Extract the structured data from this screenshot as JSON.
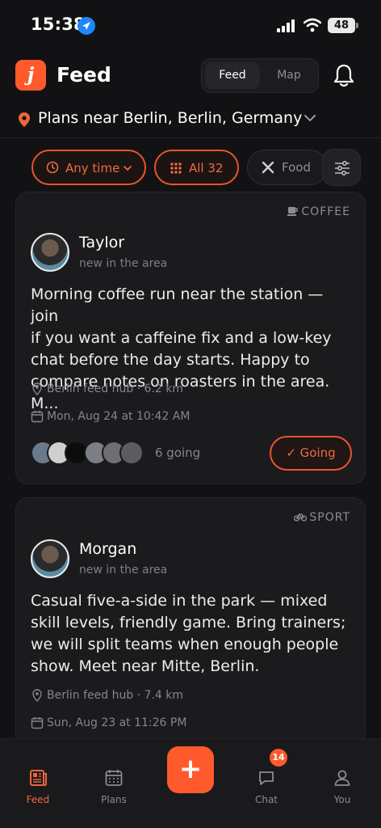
{
  "status_bar": {
    "time": "15:38",
    "battery": "48"
  },
  "header": {
    "app_title": "Feed",
    "logo_letter": "j",
    "segment": {
      "feed": "Feed",
      "map": "Map",
      "selected": "Feed"
    }
  },
  "location": {
    "text": "Plans near Berlin, Berlin, Germany"
  },
  "filters": [
    {
      "label": "Any time",
      "icon": "clock-icon",
      "active": true
    },
    {
      "label": "All 32",
      "icon": "grid-icon",
      "active": true
    },
    {
      "label": "Food",
      "icon": "utensils-icon",
      "active": false
    }
  ],
  "posts": [
    {
      "category": "COFFEE",
      "category_icon": "coffee-icon",
      "author": "Taylor",
      "subtitle": "new in the area",
      "text_lines": [
        "Morning coffee run near the station — join",
        "if you want a caffeine fix and a low-key",
        "chat before the day starts. Happy to",
        "compare notes on roasters in the area. M..."
      ],
      "place": "Berlin feed hub · 6.2 km",
      "datetime": "Mon, Aug 24 at 10:42 AM",
      "going_count": "6 going",
      "action_label": "Going",
      "action_check": "✓"
    },
    {
      "category": "SPORT",
      "category_icon": "bicycle-icon",
      "author": "Morgan",
      "subtitle": "new in the area",
      "text_lines": [
        "Casual five-a-side in the park — mixed",
        "skill levels, friendly game. Bring trainers;",
        "we will split teams when enough people",
        "show. Meet near Mitte, Berlin."
      ],
      "place": "Berlin feed hub · 7.4 km",
      "datetime": "Sun, Aug 23 at 11:26 PM"
    }
  ],
  "tabbar": {
    "tabs": [
      {
        "label": "Feed",
        "icon": "newspaper-icon",
        "active": true
      },
      {
        "label": "Plans",
        "icon": "calendar-icon",
        "active": false
      },
      {
        "label": "Chat",
        "icon": "chat-icon",
        "active": false,
        "badge": "14"
      },
      {
        "label": "You",
        "icon": "person-icon",
        "active": false
      }
    ],
    "fab": "+"
  },
  "colors": {
    "accent": "#ff5a2c",
    "background": "#121214",
    "card": "#1b1b1e"
  }
}
